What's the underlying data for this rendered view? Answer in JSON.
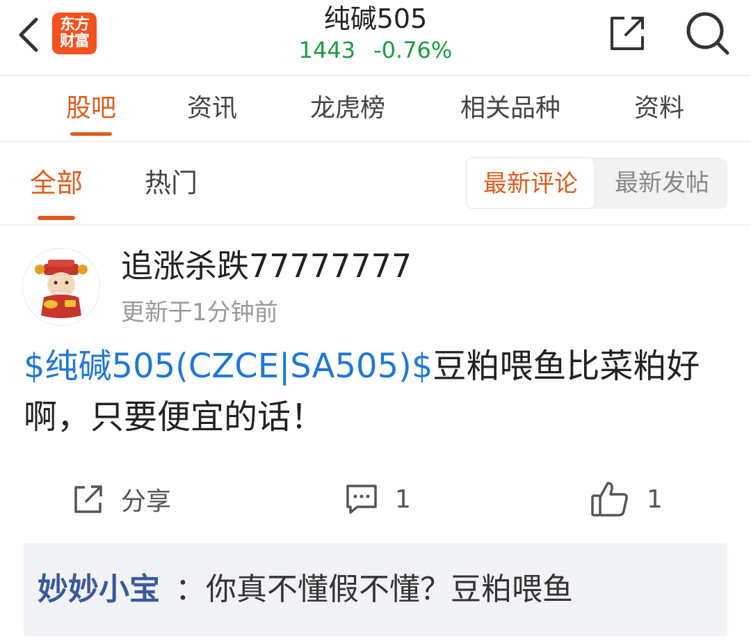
{
  "header": {
    "title": "纯碱505",
    "price": "1443",
    "change_pct": "-0.76%",
    "logo_line1": "东方",
    "logo_line2": "财富",
    "icons": [
      "back-arrow-icon",
      "share-icon",
      "search-icon"
    ]
  },
  "main_tabs": [
    {
      "label": "股吧",
      "active": true
    },
    {
      "label": "资讯",
      "active": false
    },
    {
      "label": "龙虎榜",
      "active": false
    },
    {
      "label": "相关品种",
      "active": false
    },
    {
      "label": "资料",
      "active": false
    }
  ],
  "sub_tabs": [
    {
      "label": "全部",
      "active": true
    },
    {
      "label": "热门",
      "active": false
    }
  ],
  "sort": {
    "active": "最新评论",
    "inactive": "最新发帖"
  },
  "post": {
    "username": "追涨杀跌77777777",
    "time": "更新于1分钟前",
    "stock_link": "$纯碱505(CZCE|SA505)$",
    "body": "豆粕喂鱼比菜粕好啊，只要便宜的话！",
    "share_label": "分享",
    "comment_count": "1",
    "like_count": "1"
  },
  "reply": {
    "user": "妙妙小宝",
    "text": "：你真不懂假不懂？豆粕喂鱼"
  },
  "colors": {
    "accent": "#e05a1a",
    "price_down": "#1a9c3e",
    "link": "#1e78d6",
    "reply_user": "#3a5a9a",
    "reply_bg": "#f2f3f7"
  }
}
